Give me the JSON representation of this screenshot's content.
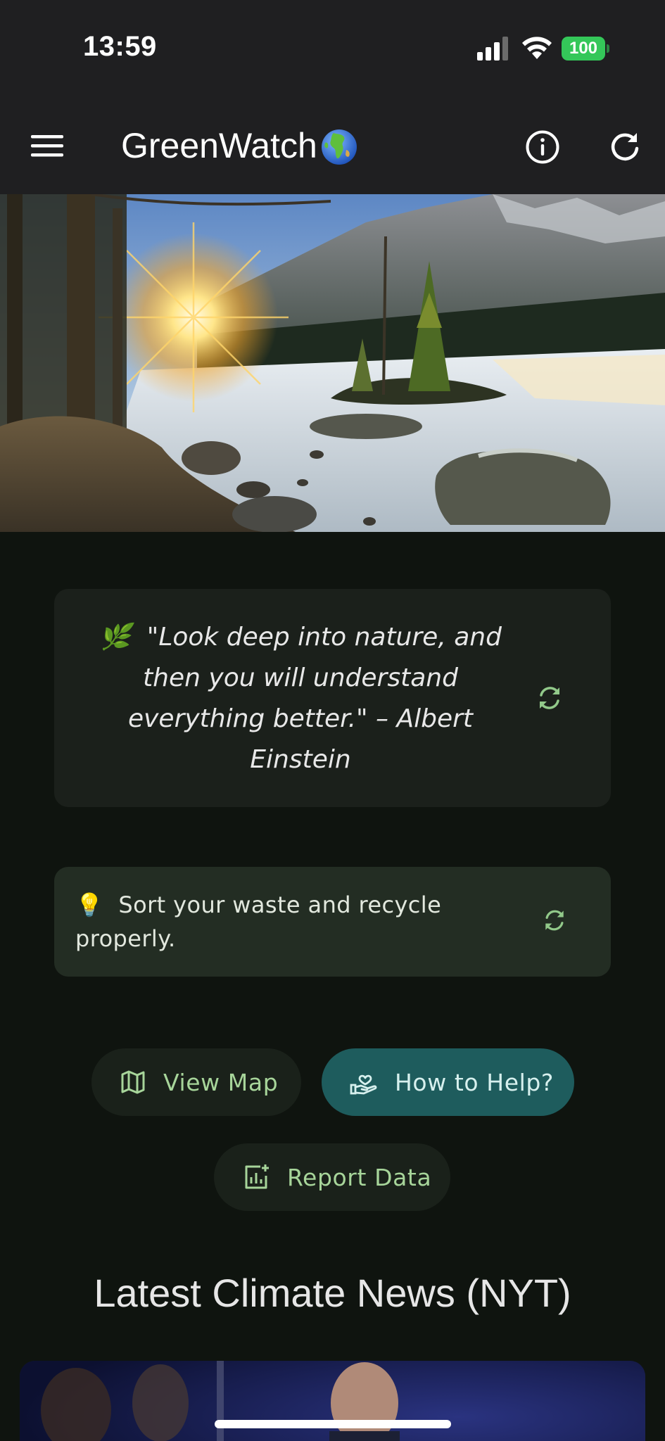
{
  "status_bar": {
    "time": "13:59",
    "battery": "100",
    "battery_color": "#34c759"
  },
  "app_bar": {
    "title": "GreenWatch",
    "title_emoji": "globe-europe-africa",
    "icons": [
      "menu-icon",
      "info-icon",
      "refresh-icon"
    ]
  },
  "hero": {
    "icon": "mountain-lake-sunrise-image"
  },
  "quote": {
    "emoji": "🌿",
    "text": "\"Look deep into nature, and then you will understand everything better.\" – Albert Einstein"
  },
  "tip": {
    "emoji": "💡",
    "text": "Sort your waste and recycle properly."
  },
  "actions": {
    "view_map": "View Map",
    "how_to_help": "How to Help?",
    "report_data": "Report Data"
  },
  "news": {
    "heading": "Latest Climate News (NYT)"
  },
  "colors": {
    "background": "#0f140f",
    "app_bar": "#1f1f21",
    "accent_green": "#a7d59a",
    "help_button": "#1e5c5d"
  }
}
